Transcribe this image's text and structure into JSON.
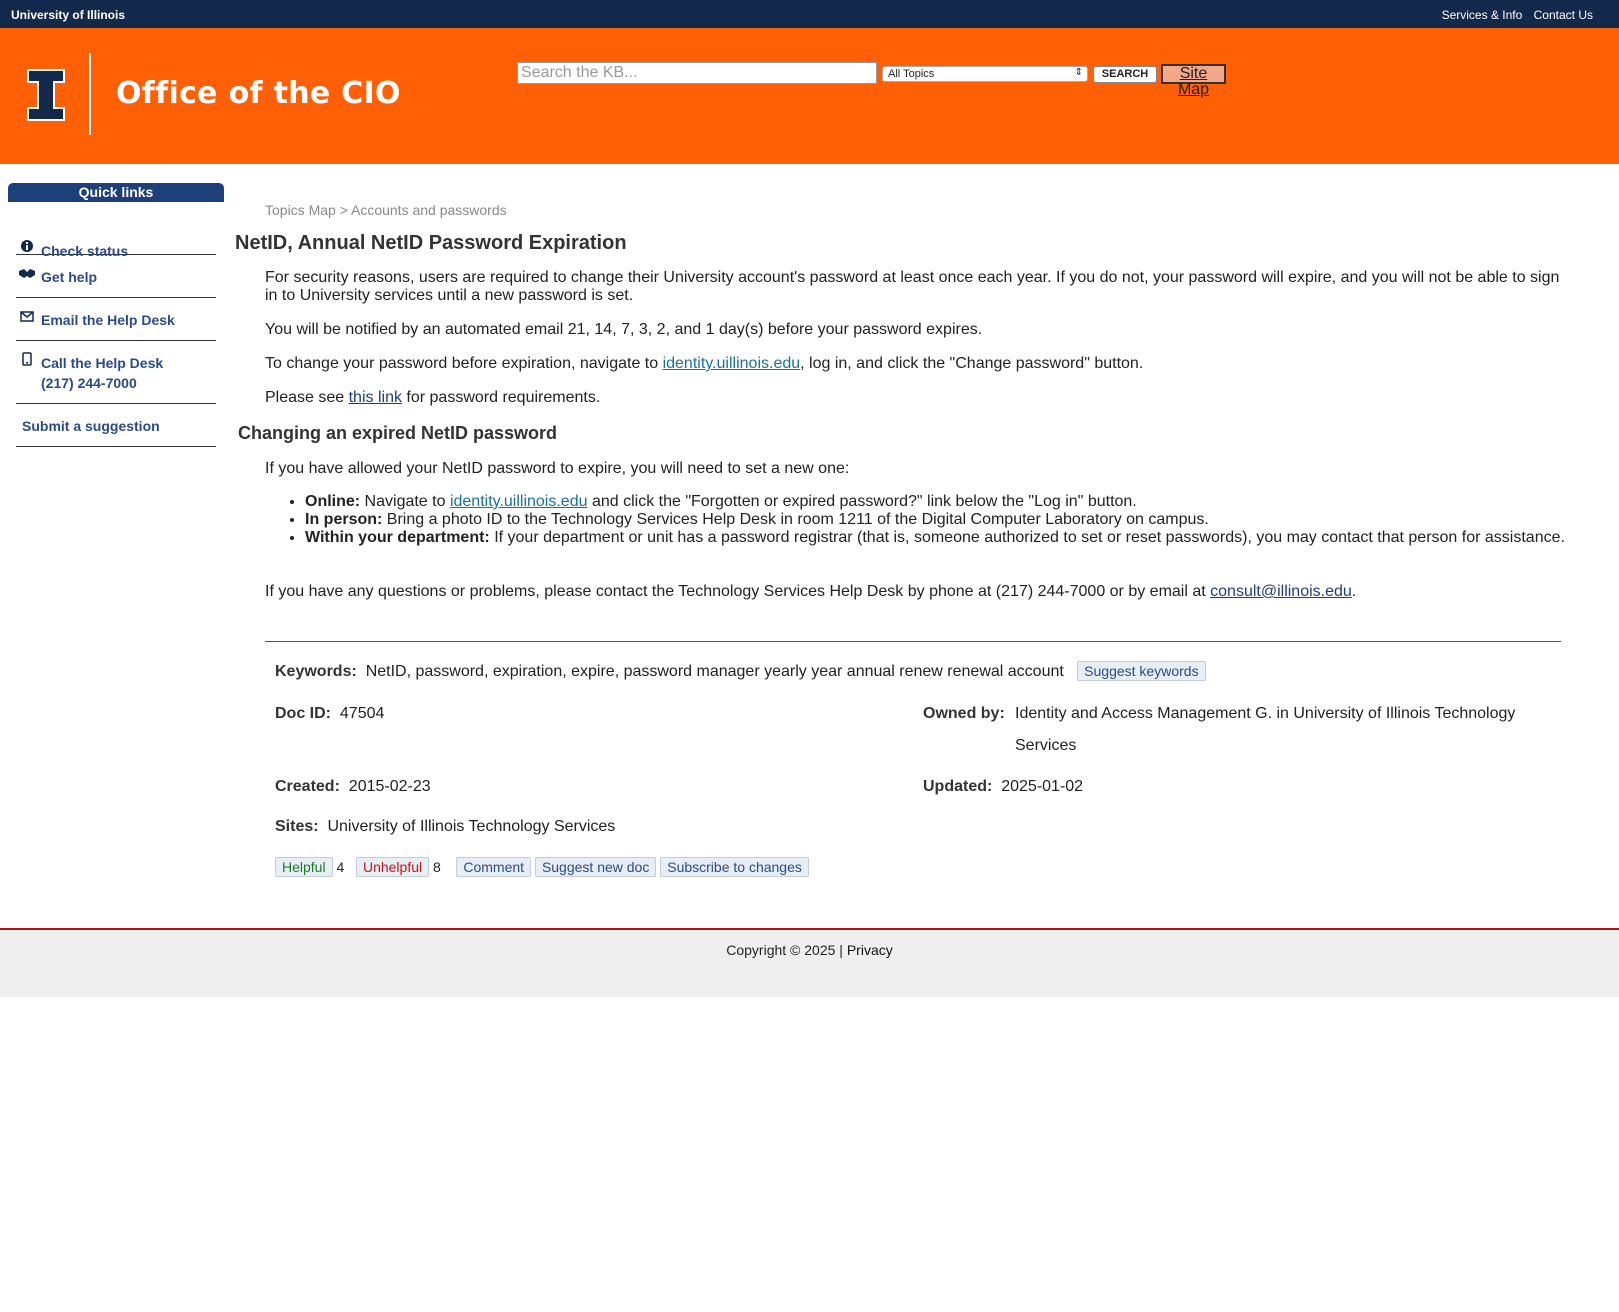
{
  "topbar": {
    "brand": "University of Illinois",
    "links": [
      "Services & Info",
      "Contact Us"
    ]
  },
  "header": {
    "logo_icon": "block-i-logo",
    "title": "Office of the CIO",
    "search_placeholder": "Search the KB...",
    "topic_select": "All Topics",
    "search_button": "SEARCH",
    "sitemap_button": "Site Map"
  },
  "sidebar": {
    "heading": "Quick links",
    "items": [
      {
        "label": "Check status",
        "icon": "info-icon"
      },
      {
        "label": "Get help",
        "icon": "handshake-icon"
      },
      {
        "label": "Email the Help Desk",
        "icon": "envelope-icon"
      },
      {
        "label": "Call the Help Desk",
        "sub": "(217) 244-7000",
        "icon": "phone-icon"
      },
      {
        "label": "Submit a suggestion"
      }
    ]
  },
  "article": {
    "breadcrumb": "Topics Map > Accounts and passwords",
    "title": "NetID, Annual NetID Password Expiration",
    "p1": "For security reasons, users are required to change their University account's password at least once each year. If you do not, your password will expire, and you will not be able to sign in to University services until a new password is set.",
    "p2": "You will be notified by an automated email 21, 14, 7, 3, 2, and 1 day(s) before your password expires.",
    "p3_before": "To change your password before expiration, navigate to ",
    "p3_link": "identity.uillinois.edu",
    "p3_after": ", log in, and click the \"Change password\" button.",
    "p4_before": "Please see ",
    "p4_link": "this link",
    "p4_after": " for password requirements.",
    "h2": "Changing an expired NetID password",
    "p5": "If you have allowed your NetID password to expire, you will need to set a new one:",
    "bullets": [
      {
        "bold": "Online:",
        "before": " Navigate to ",
        "link": "identity.uillinois.edu",
        "after": " and click the \"Forgotten or expired password?\" link below the \"Log in\" button."
      },
      {
        "bold": "In person:",
        "text": " Bring a photo ID to the Technology Services Help Desk in room 1211 of the Digital Computer Laboratory on campus."
      },
      {
        "bold": "Within your department:",
        "text": " If your department or unit has a password registrar (that is, someone authorized to set or reset passwords), you may contact that person for assistance."
      }
    ],
    "p6_before": "If you have any questions or problems, please contact the Technology Services Help Desk by phone at (217) 244-7000 or by email at ",
    "p6_link": "consult@illinois.edu",
    "p6_after": "."
  },
  "meta": {
    "keywords_label": "Keywords:",
    "keywords": "NetID, password, expiration, expire, password manager yearly year annual renew renewal account",
    "suggest_keywords": "Suggest keywords",
    "docid_label": "Doc ID:",
    "docid": "47504",
    "owned_label": "Owned by:",
    "owned_line1": "Identity and Access Management G. in University of Illinois Technology",
    "owned_line2": "Services",
    "created_label": "Created:",
    "created": "2015-02-23",
    "updated_label": "Updated:",
    "updated": "2025-01-02",
    "sites_label": "Sites:",
    "sites": "University of Illinois Technology Services",
    "helpful": "Helpful",
    "helpful_count": "4",
    "unhelpful": "Unhelpful",
    "unhelpful_count": "8",
    "comment": "Comment",
    "suggest_doc": "Suggest new doc",
    "subscribe": "Subscribe to changes"
  },
  "footer": {
    "copyright": "Copyright © 2025 | ",
    "privacy": "Privacy"
  }
}
